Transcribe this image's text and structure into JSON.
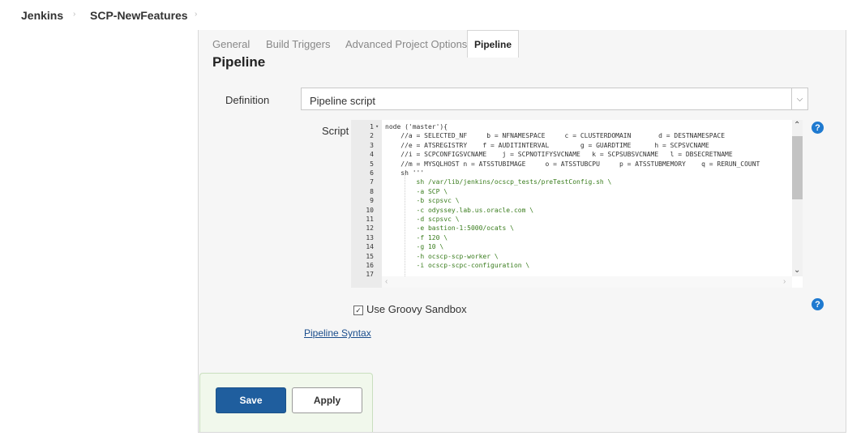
{
  "breadcrumb": {
    "items": [
      "Jenkins",
      "SCP-NewFeatures"
    ],
    "separator": "›"
  },
  "tabs": [
    "General",
    "Build Triggers",
    "Advanced Project Options",
    "Pipeline"
  ],
  "active_tab": "Pipeline",
  "section": {
    "title": "Pipeline"
  },
  "definition": {
    "label": "Definition",
    "value": "Pipeline script"
  },
  "script": {
    "label": "Script",
    "lines": [
      {
        "n": "1",
        "text": "node ('master'){",
        "color": "plain",
        "fold": "▾"
      },
      {
        "n": "2",
        "text": "    //a = SELECTED_NF     b = NFNAMESPACE     c = CLUSTERDOMAIN       d = DESTNAMESPACE",
        "color": "plain"
      },
      {
        "n": "3",
        "text": "    //e = ATSREGISTRY    f = AUDITINTERVAL        g = GUARDTIME      h = SCPSVCNAME",
        "color": "plain"
      },
      {
        "n": "4",
        "text": "    //i = SCPCONFIGSVCNAME    j = SCPNOTIFYSVCNAME   k = SCPSUBSVCNAME   l = DBSECRETNAME",
        "color": "plain"
      },
      {
        "n": "5",
        "text": "    //m = MYSQLHOST n = ATSSTUBIMAGE     o = ATSSTUBCPU     p = ATSSTUBMEMORY    q = RERUN_COUNT",
        "color": "plain"
      },
      {
        "n": "6",
        "text": "    sh '''",
        "color": "plain"
      },
      {
        "n": "7",
        "text": "        sh /var/lib/jenkins/ocscp_tests/preTestConfig.sh \\",
        "color": "green"
      },
      {
        "n": "8",
        "text": "        -a SCP \\",
        "color": "green"
      },
      {
        "n": "9",
        "text": "        -b scpsvc \\",
        "color": "green"
      },
      {
        "n": "10",
        "text": "        -c odyssey.lab.us.oracle.com \\",
        "color": "green"
      },
      {
        "n": "11",
        "text": "        -d scpsvc \\",
        "color": "green"
      },
      {
        "n": "12",
        "text": "        -e bastion-1:5000/ocats \\",
        "color": "green"
      },
      {
        "n": "13",
        "text": "        -f 120 \\",
        "color": "green"
      },
      {
        "n": "14",
        "text": "        -g 10 \\",
        "color": "green"
      },
      {
        "n": "15",
        "text": "        -h ocscp-scp-worker \\",
        "color": "green"
      },
      {
        "n": "16",
        "text": "        -i ocscp-scpc-configuration \\",
        "color": "green"
      },
      {
        "n": "17",
        "text": "",
        "color": "plain"
      }
    ]
  },
  "sandbox": {
    "label": "Use Groovy Sandbox",
    "checked": true,
    "check_glyph": "✓"
  },
  "pipeline_syntax": {
    "label": "Pipeline Syntax"
  },
  "buttons": {
    "save": "Save",
    "apply": "Apply"
  },
  "help": {
    "glyph": "?"
  },
  "colors": {
    "accent": "#1f5e9e",
    "help": "#1f7ad0",
    "code_green": "#3a7d1e"
  }
}
